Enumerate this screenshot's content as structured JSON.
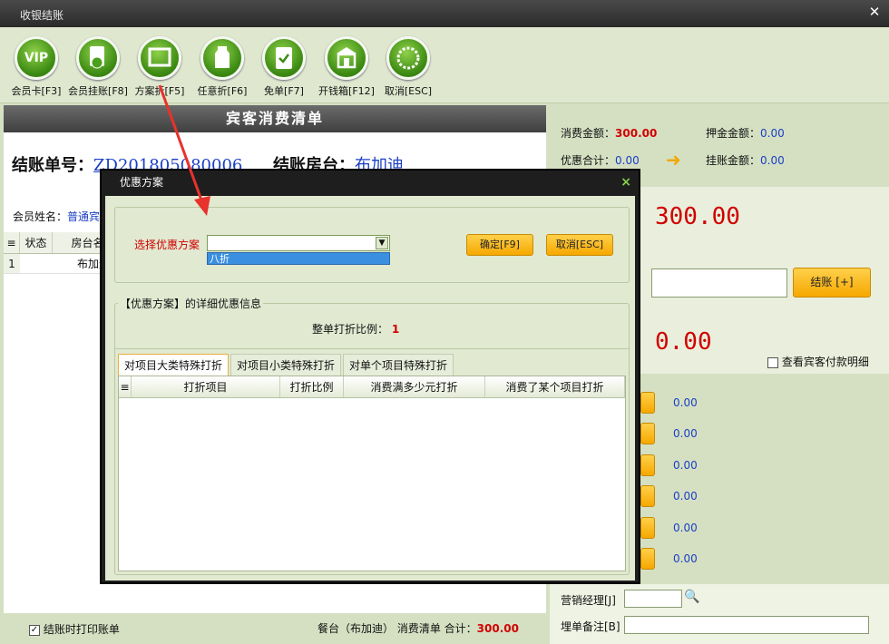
{
  "window": {
    "title": "收银结账",
    "close": "✕"
  },
  "toolbar": [
    {
      "label": "会员卡[F3]",
      "icon": "VIP"
    },
    {
      "label": "会员挂账[F8]",
      "icon": "doc"
    },
    {
      "label": "方案折[F5]",
      "icon": "window"
    },
    {
      "label": "任意折[F6]",
      "icon": "bottle"
    },
    {
      "label": "免单[F7]",
      "icon": "clipboard-check"
    },
    {
      "label": "开钱箱[F12]",
      "icon": "cashbox"
    },
    {
      "label": "取消[ESC]",
      "icon": "cancel"
    }
  ],
  "left": {
    "header": "宾客消费清单",
    "bill_no_label": "结账单号：",
    "bill_no": "ZD201805080006",
    "room_label": "结账房台：",
    "room": "布加迪",
    "member_label": "会员姓名：",
    "member": "普通宾",
    "grid": {
      "columns": [
        "状态",
        "房台名称"
      ],
      "rows": [
        {
          "no": "1",
          "status": "",
          "room": "布加迪"
        }
      ]
    },
    "print_label": "结账时打印账单",
    "summary": "餐台（布加迪） 消费清单 合计：",
    "summary_total": "300.00"
  },
  "right": {
    "consume_label": "消费金额：",
    "consume": "300.00",
    "deposit_label": "押金金额：",
    "deposit": "0.00",
    "discount_label": "优惠合计：",
    "discount": "0.00",
    "charge_label": "挂账金额：",
    "charge": "0.00",
    "due": "300.00",
    "checkout_btn": "结账 [+]",
    "change": "0.00",
    "detail_label": "查看宾客付款明细",
    "payments": [
      "0.00",
      "0.00",
      "0.00",
      "0.00",
      "0.00",
      "0.00"
    ],
    "manager_label": "营销经理[J]",
    "remark_label": "埋单备注[B]"
  },
  "dialog": {
    "title": "优惠方案",
    "close": "×",
    "select_label": "选择优惠方案",
    "select_value": "",
    "dropdown_option": "八折",
    "ok": "确定[F9]",
    "cancel": "取消[ESC]",
    "detail_group": "【优惠方案】的详细优惠信息",
    "ratio_label": "整单打折比例：",
    "ratio": "1",
    "tabs": [
      "对项目大类特殊打折",
      "对项目小类特殊打折",
      "对单个项目特殊打折"
    ],
    "columns": [
      "打折项目",
      "打折比例",
      "消费满多少元打折",
      "消费了某个项目打折"
    ]
  },
  "colors": {
    "accent_red": "#d10000",
    "link_blue": "#1a3fc6",
    "button_yellow": "#f6a800"
  }
}
